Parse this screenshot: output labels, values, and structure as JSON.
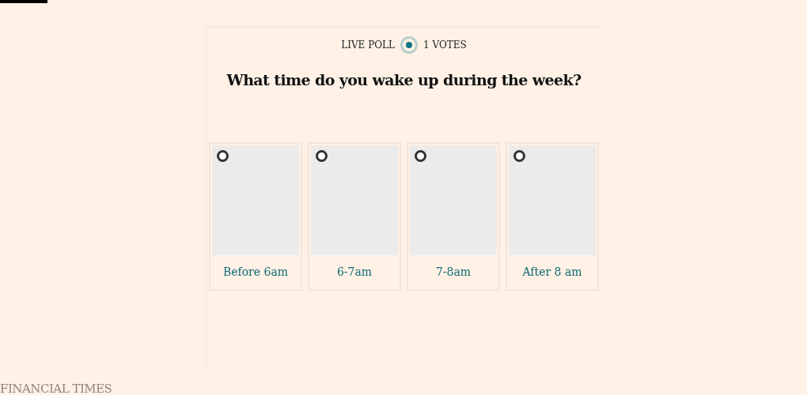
{
  "poll": {
    "label": "LIVE POLL",
    "votes": "1 VOTES",
    "question": "What time do you wake up during the week?",
    "options": [
      {
        "label": "Before 6am",
        "selected": false
      },
      {
        "label": "6-7am",
        "selected": false
      },
      {
        "label": "7-8am",
        "selected": false
      },
      {
        "label": "After 8 am",
        "selected": false
      }
    ]
  },
  "footer": {
    "brand": "FINANCIAL TIMES"
  }
}
